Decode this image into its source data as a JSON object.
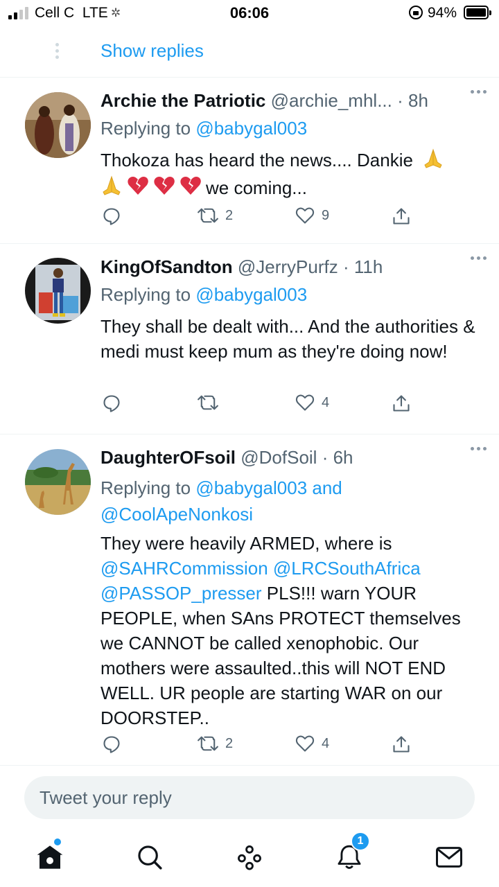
{
  "status_bar": {
    "carrier": "Cell C",
    "network": "LTE",
    "time": "06:06",
    "battery": "94%"
  },
  "show_replies": "Show replies",
  "tweets": [
    {
      "display_name": "Archie the Patriotic",
      "handle": "@archie_mhl...",
      "time": "· 8h",
      "replying_prefix": "Replying to ",
      "replying_handles": "@babygal003",
      "line1": "Thokoza has heard the news.... Dankie",
      "line2": "we coming...",
      "emoji_icons": [
        "folded-hands",
        "folded-hands",
        "broken-heart",
        "broken-heart",
        "broken-heart"
      ],
      "retweets": "2",
      "likes": "9"
    },
    {
      "display_name": "KingOfSandton",
      "handle": "@JerryPurfz",
      "time": "· 11h",
      "replying_prefix": "Replying to ",
      "replying_handles": "@babygal003",
      "text": "They shall be dealt with... And the authorities & medi must keep mum as they're doing now!",
      "retweets": "",
      "likes": "4"
    },
    {
      "display_name": "DaughterOFsoil",
      "handle": "@DofSoil",
      "time": "· 6h",
      "replying_prefix": "Replying to ",
      "replying_handles": "@babygal003 and",
      "replying_handles_2": "@CoolApeNonkosi",
      "text_line1": "They were heavily ARMED, where is",
      "mention1": "@SAHRCommission",
      "mention2": "@LRCSouthAfrica",
      "mention3": "@PASSOP_presser",
      "text_rest": " PLS!!! warn YOUR PEOPLE, when SAns PROTECT themselves we CANNOT be called xenophobic. Our mothers were assaulted..this will NOT END WELL. UR people are starting WAR on our DOORSTEP..",
      "retweets": "2",
      "likes": "4"
    }
  ],
  "composer": {
    "placeholder": "Tweet your reply"
  },
  "nav": {
    "notifications_badge": "1",
    "items": [
      "home-icon",
      "search-icon",
      "spaces-icon",
      "notifications-icon",
      "messages-icon"
    ]
  },
  "colors": {
    "accent": "#1d9bf0",
    "text": "#0f1419",
    "muted": "#536471",
    "like_red": "#e0245e"
  }
}
